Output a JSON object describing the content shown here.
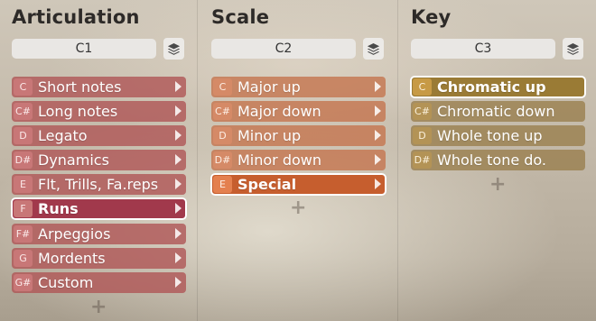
{
  "columns": [
    {
      "title": "Articulation",
      "slot": "C1",
      "rows": [
        {
          "key": "C",
          "label": "Short notes"
        },
        {
          "key": "C#",
          "label": "Long notes"
        },
        {
          "key": "D",
          "label": "Legato"
        },
        {
          "key": "D#",
          "label": "Dynamics"
        },
        {
          "key": "E",
          "label": "Flt, Trills, Fa.reps"
        },
        {
          "key": "F",
          "label": "Runs"
        },
        {
          "key": "F#",
          "label": "Arpeggios"
        },
        {
          "key": "G",
          "label": "Mordents"
        },
        {
          "key": "G#",
          "label": "Custom"
        }
      ],
      "selected_index": 5,
      "add_label": "+"
    },
    {
      "title": "Scale",
      "slot": "C2",
      "rows": [
        {
          "key": "C",
          "label": "Major up"
        },
        {
          "key": "C#",
          "label": "Major down"
        },
        {
          "key": "D",
          "label": "Minor up"
        },
        {
          "key": "D#",
          "label": "Minor down"
        },
        {
          "key": "E",
          "label": "Special"
        }
      ],
      "selected_index": 4,
      "add_label": "+"
    },
    {
      "title": "Key",
      "slot": "C3",
      "rows": [
        {
          "key": "C",
          "label": "Chromatic up"
        },
        {
          "key": "C#",
          "label": "Chromatic down"
        },
        {
          "key": "D",
          "label": "Whole tone up"
        },
        {
          "key": "D#",
          "label": "Whole tone do."
        }
      ],
      "selected_index": 0,
      "add_label": "+"
    }
  ],
  "icons": {
    "slot_menu": "layers-icon",
    "row_arrow": "chevron-right-icon",
    "add": "plus-icon"
  },
  "colors": {
    "articulation_row": "#b05858",
    "scale_row": "#c47650",
    "key_row": "#987e4c",
    "selected_outline": "#ffffff"
  }
}
